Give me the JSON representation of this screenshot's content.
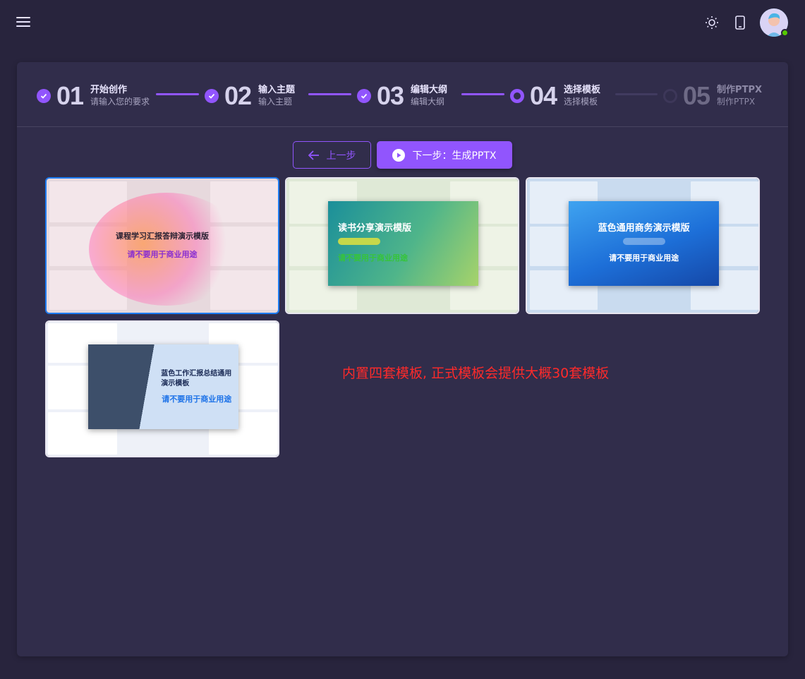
{
  "header": {
    "menu_icon": "menu-icon",
    "theme_icon": "sun-icon",
    "device_icon": "phone-icon",
    "avatar_status_color": "#56CA00"
  },
  "stepper": {
    "steps": [
      {
        "number": "01",
        "title": "开始创作",
        "subtitle": "请输入您的要求",
        "state": "done"
      },
      {
        "number": "02",
        "title": "输入主题",
        "subtitle": "输入主题",
        "state": "done"
      },
      {
        "number": "03",
        "title": "编辑大纲",
        "subtitle": "编辑大纲",
        "state": "done"
      },
      {
        "number": "04",
        "title": "选择模板",
        "subtitle": "选择模板",
        "state": "current"
      },
      {
        "number": "05",
        "title": "制作PTPX",
        "subtitle": "制作PTPX",
        "state": "future"
      }
    ]
  },
  "actions": {
    "prev_label": "上一步",
    "next_label": "下一步：生成PPTX"
  },
  "templates": [
    {
      "title": "课程学习汇报答辩演示模版",
      "subtitle": "请不要用于商业用途",
      "selected": true
    },
    {
      "title": "读书分享演示模版",
      "subtitle": "请不要用于商业用途",
      "selected": false
    },
    {
      "title": "蓝色通用商务演示模版",
      "subtitle": "请不要用于商业用途",
      "selected": false
    },
    {
      "title": "蓝色工作汇报总结通用演示模板",
      "subtitle": "请不要用于商业用途",
      "selected": false
    }
  ],
  "notice": "内置四套模板, 正式模板会提供大概30套模板",
  "colors": {
    "primary": "#9155FD",
    "background": "#28243D",
    "card": "#312D4B",
    "notice": "#FF2A2A",
    "selected_border": "#1E7CF2"
  }
}
